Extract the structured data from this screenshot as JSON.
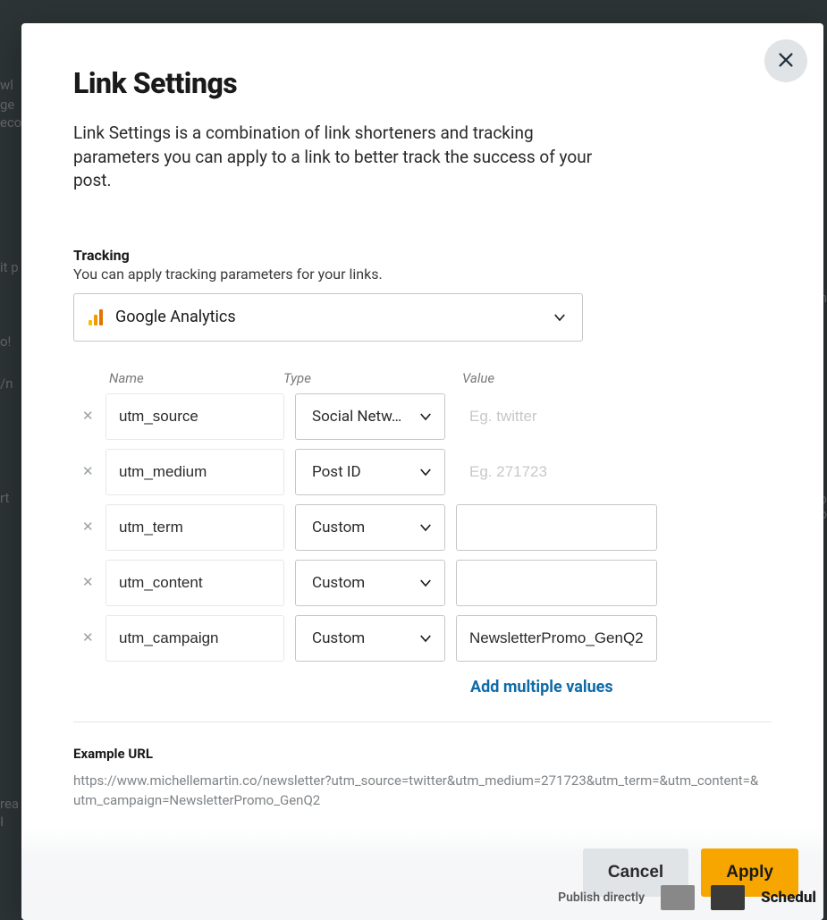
{
  "modal": {
    "title": "Link Settings",
    "description": "Link Settings is a combination of link shorteners and tracking parameters you can apply to a link to better track the success of your post.",
    "tracking": {
      "label": "Tracking",
      "sub": "You can apply tracking parameters for your links.",
      "selected": "Google Analytics"
    },
    "columns": {
      "name": "Name",
      "type": "Type",
      "value": "Value"
    },
    "rows": [
      {
        "name": "utm_source",
        "type": "Social Netw…",
        "value": "",
        "placeholder": "Eg. twitter",
        "value_border": false
      },
      {
        "name": "utm_medium",
        "type": "Post ID",
        "value": "",
        "placeholder": "Eg. 271723",
        "value_border": false
      },
      {
        "name": "utm_term",
        "type": "Custom",
        "value": "",
        "placeholder": "",
        "value_border": true
      },
      {
        "name": "utm_content",
        "type": "Custom",
        "value": "",
        "placeholder": "",
        "value_border": true
      },
      {
        "name": "utm_campaign",
        "type": "Custom",
        "value": "NewsletterPromo_GenQ2",
        "placeholder": "",
        "value_border": true
      }
    ],
    "add_multiple": "Add multiple values",
    "example": {
      "label": "Example URL",
      "url": "https://www.michellemartin.co/newsletter?utm_source=twitter&utm_medium=271723&utm_term=&utm_content=&utm_campaign=NewsletterPromo_GenQ2"
    },
    "buttons": {
      "cancel": "Cancel",
      "apply": "Apply"
    }
  },
  "background": {
    "publish": "Publish directly",
    "schedule": "Schedul"
  }
}
